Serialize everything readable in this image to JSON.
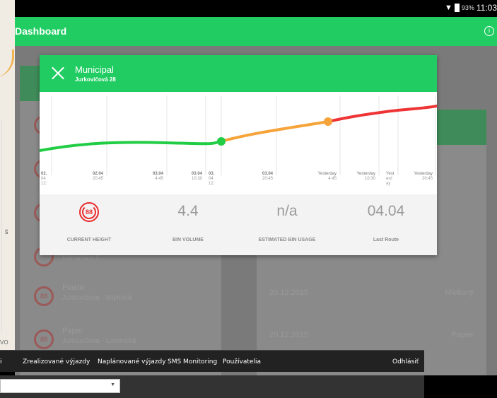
{
  "statusbar": {
    "battery": "93%",
    "time": "11:03"
  },
  "appbar": {
    "title": "Dashboard"
  },
  "map": {
    "label": "š",
    "label2": "VO"
  },
  "background_list": [
    {
      "badge": "88",
      "title": "",
      "sub": ""
    },
    {
      "badge": "",
      "title": "",
      "sub": ""
    },
    {
      "badge": "",
      "title": "",
      "sub": ""
    },
    {
      "badge": "",
      "title": "",
      "sub": "Nitrianska 5"
    },
    {
      "badge": "88",
      "title": "Plastic",
      "sub": "Jurkovičova - Mlynská"
    },
    {
      "badge": "88",
      "title": "Paper",
      "sub": "Jurkovičova - Lomnická"
    }
  ],
  "background_right": [
    {
      "date": "20.12.2015",
      "kind": "Miešaný"
    },
    {
      "date": "20.12.2015",
      "kind": "Papier"
    }
  ],
  "modal": {
    "title": "Municipal",
    "subtitle": "Jurkovičová 28",
    "stats": [
      {
        "value": "88",
        "label": "CURRENT HEIGHT"
      },
      {
        "value": "4.4",
        "label": "BIN VOLUME"
      },
      {
        "value": "n/a",
        "label": "ESTIMATED BIN USAGE"
      },
      {
        "value": "04.04",
        "label": "Last Route"
      }
    ]
  },
  "chart_data": {
    "type": "line",
    "x_ticks": [
      {
        "date": "02.",
        "day": "04",
        "time": "12:"
      },
      {
        "date": "02.04",
        "time": "20:45"
      },
      {
        "date": "03.04",
        "time": "4:45"
      },
      {
        "date": "03.04",
        "time": "10:30"
      },
      {
        "date": "03.",
        "day": "04",
        "time": "12:"
      },
      {
        "date": "03.04",
        "time": "20:45"
      },
      {
        "date": "Yesterday",
        "time": "4:45"
      },
      {
        "date": "Yesterday",
        "time": "10:30"
      },
      {
        "date": "Yest",
        "day": "erd",
        "time": "ay"
      },
      {
        "date": "Yesterday",
        "time": "20:45"
      }
    ],
    "colors": {
      "green": "#21cd44",
      "orange": "#f6a43a",
      "red": "#ee3434"
    }
  },
  "webnav": {
    "cut_label": "i",
    "items": [
      "Zrealizované výjazdy",
      "Naplánované výjazdy",
      "SMS Monitoring",
      "Používatelia"
    ],
    "logout": "Odhlásiť"
  },
  "filter": {
    "arrow": "▼"
  }
}
